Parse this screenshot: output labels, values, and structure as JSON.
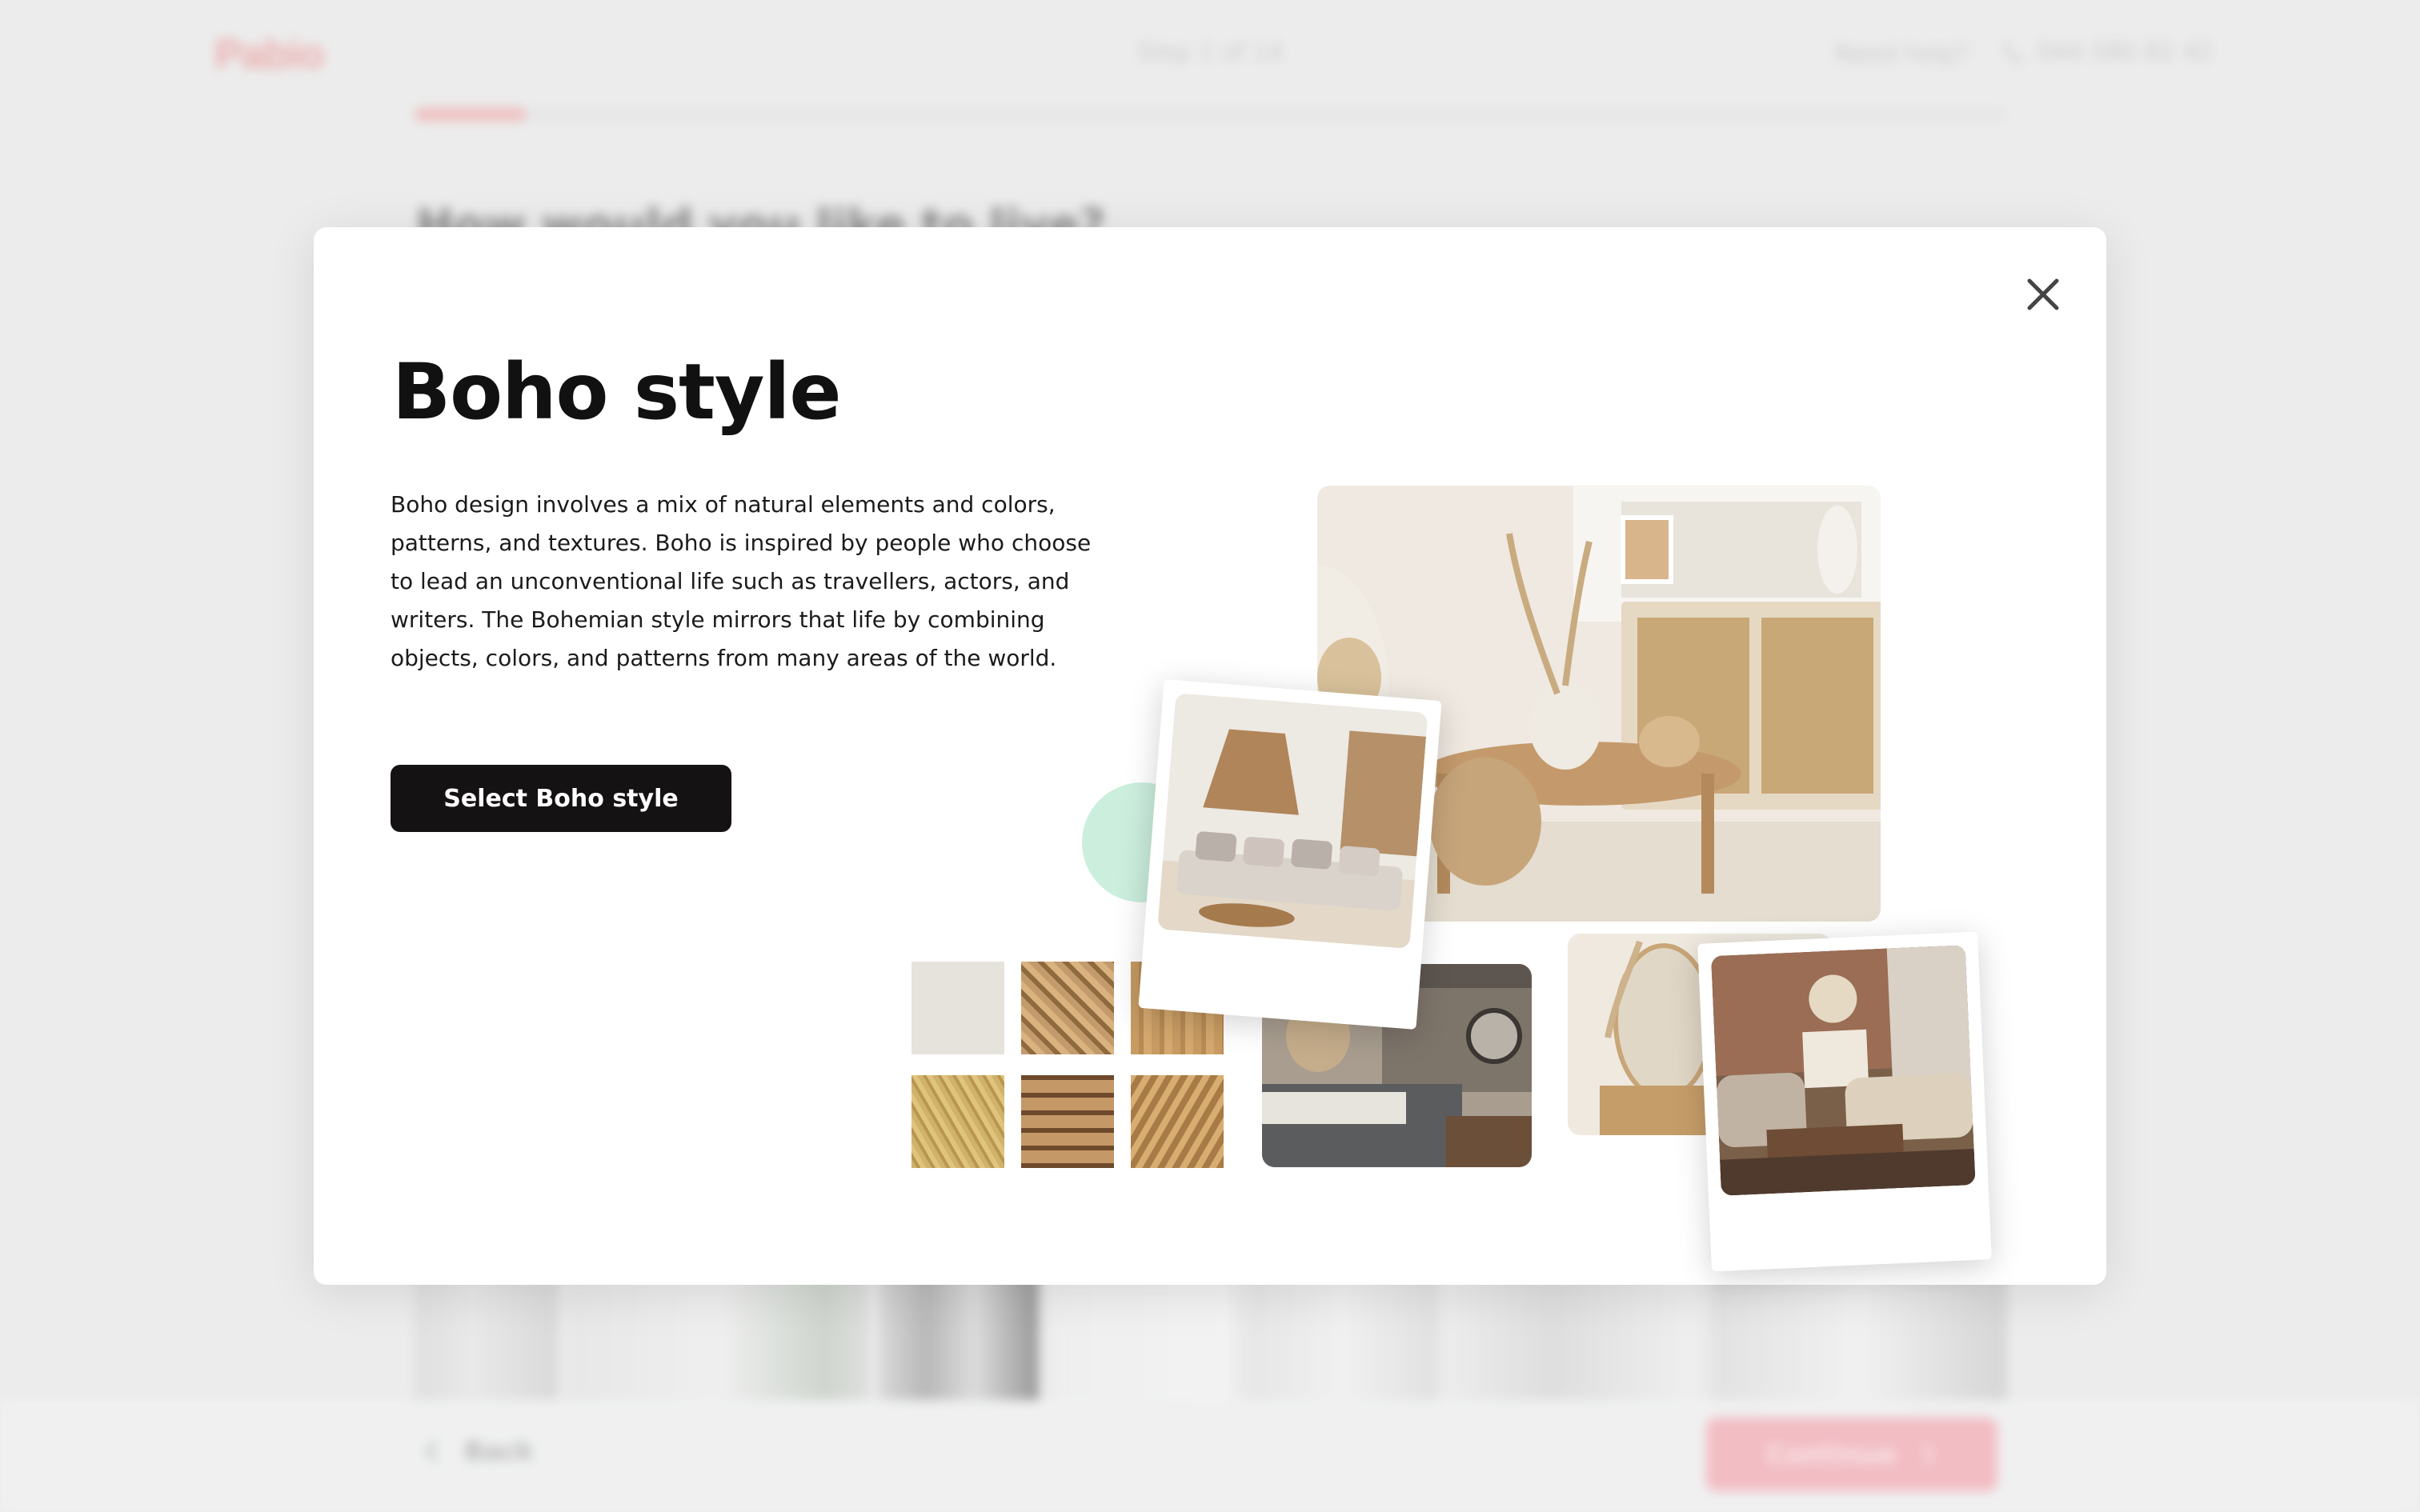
{
  "background": {
    "logo": "Pabio",
    "step": "Step 1 of 14",
    "help": "Need help?",
    "phone": "044 580 82 42",
    "question": "How would you like to live?",
    "progress_fraction": 0.07,
    "footer": {
      "back_label": "Back",
      "continue_label": "Continue"
    }
  },
  "modal": {
    "title": "Boho style",
    "description": "Boho design involves a mix of natural elements and colors, patterns, and textures. Boho is inspired by people who choose to lead an unconventional life such as travellers, actors, and writers. The Bohemian style mirrors that life by combining objects, colors, and patterns from many areas of the world.",
    "select_button": "Select Boho style"
  },
  "colors": {
    "brand_pink": "#e98c8c",
    "button_dark": "#151213",
    "mint_accent": "#cbeedd"
  }
}
